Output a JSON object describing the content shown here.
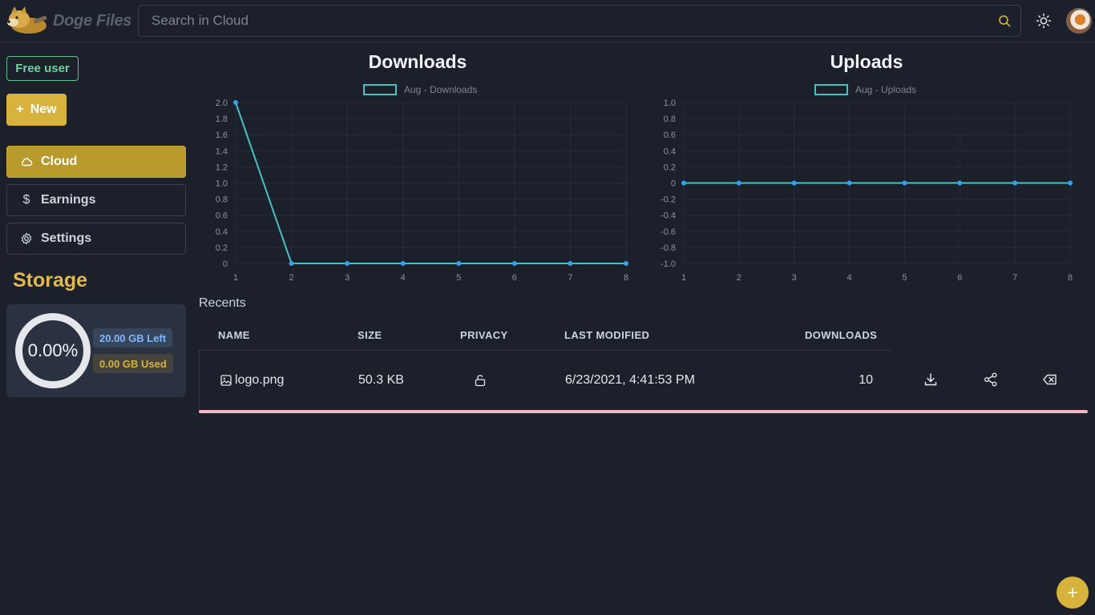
{
  "header": {
    "app_name": "Doge Files",
    "search_placeholder": "Search in Cloud",
    "search_value": ""
  },
  "sidebar": {
    "plan_badge": "Free user",
    "new_button": "New",
    "items": [
      {
        "label": "Cloud",
        "icon": "cloud-icon",
        "active": true
      },
      {
        "label": "Earnings",
        "icon": "dollar-icon",
        "active": false
      },
      {
        "label": "Settings",
        "icon": "gear-icon",
        "active": false
      }
    ],
    "storage": {
      "title": "Storage",
      "percent_used": "0.00%",
      "left": "20.00 GB Left",
      "used": "0.00 GB Used"
    }
  },
  "chart_data": [
    {
      "type": "line",
      "title": "Downloads",
      "legend": [
        "Aug - Downloads"
      ],
      "x": [
        1,
        2,
        3,
        4,
        5,
        6,
        7,
        8
      ],
      "series": [
        {
          "name": "Aug - Downloads",
          "values": [
            2,
            0,
            0,
            0,
            0,
            0,
            0,
            0
          ]
        }
      ],
      "ylim": [
        0,
        2
      ],
      "yticks": [
        "2.0",
        "1.8",
        "1.6",
        "1.4",
        "1.2",
        "1.0",
        "0.8",
        "0.6",
        "0.4",
        "0.2",
        "0"
      ],
      "grid": true,
      "legend_position": "top",
      "color": "#4bc0c0"
    },
    {
      "type": "line",
      "title": "Uploads",
      "legend": [
        "Aug - Uploads"
      ],
      "x": [
        1,
        2,
        3,
        4,
        5,
        6,
        7,
        8
      ],
      "series": [
        {
          "name": "Aug - Uploads",
          "values": [
            0,
            0,
            0,
            0,
            0,
            0,
            0,
            0
          ]
        }
      ],
      "ylim": [
        -1,
        1
      ],
      "yticks": [
        "1.0",
        "0.8",
        "0.6",
        "0.4",
        "0.2",
        "0",
        "-0.2",
        "-0.4",
        "-0.6",
        "-0.8",
        "-1.0"
      ],
      "grid": true,
      "legend_position": "top",
      "color": "#4bc0c0"
    }
  ],
  "recents": {
    "label": "Recents",
    "columns": [
      "NAME",
      "SIZE",
      "PRIVACY",
      "LAST MODIFIED",
      "DOWNLOADS"
    ],
    "rows": [
      {
        "name": "logo.png",
        "size": "50.3 KB",
        "privacy_icon": "unlock-icon",
        "last_modified": "6/23/2021, 4:41:53 PM",
        "downloads": "10"
      }
    ]
  },
  "colors": {
    "accent": "#d7b33d",
    "background": "#1b202b",
    "line": "#4bc0c0",
    "point": "#36a2eb"
  }
}
